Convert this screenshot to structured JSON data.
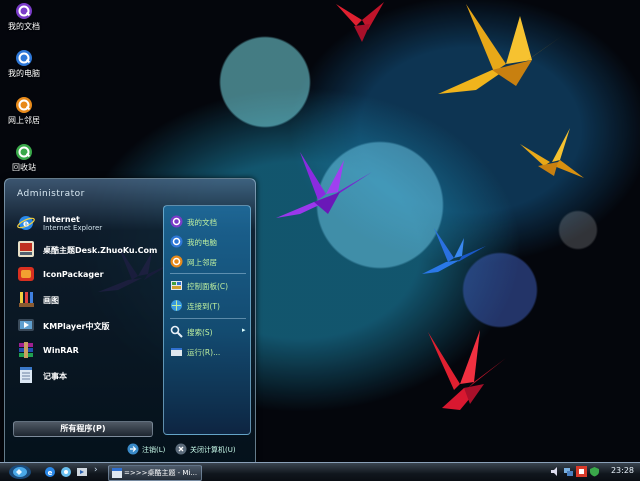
{
  "desktop": {
    "icons": [
      {
        "label": "我的文档",
        "icon": "quicktime-style-q-icon"
      },
      {
        "label": "我的电脑",
        "icon": "quicktime-style-q-icon"
      },
      {
        "label": "网上邻居",
        "icon": "quicktime-style-q-icon"
      },
      {
        "label": "回收站",
        "icon": "quicktime-style-q-icon"
      }
    ],
    "accent_colors": {
      "crane_red": "#d81830",
      "crane_yellow": "#f0b020",
      "crane_purple": "#9030e0",
      "crane_blue": "#2a70e0"
    }
  },
  "start_menu": {
    "user": "Administrator",
    "pinned": [
      {
        "title": "Internet",
        "subtitle": "Internet Explorer",
        "icon": "internet-explorer-icon"
      },
      {
        "title": "桌酷主题Desk.ZhuoKu.Com",
        "icon": "theme-app-icon"
      },
      {
        "title": "IconPackager",
        "icon": "iconpackager-icon"
      },
      {
        "title": "画图",
        "icon": "paint-brush-icon"
      },
      {
        "title": "KMPlayer中文版",
        "icon": "kmplayer-icon"
      },
      {
        "title": "WinRAR",
        "icon": "winrar-icon"
      },
      {
        "title": "记事本",
        "icon": "notepad-icon"
      }
    ],
    "places": [
      {
        "label": "我的文档",
        "icon": "documents-icon"
      },
      {
        "label": "我的电脑",
        "icon": "computer-icon"
      },
      {
        "label": "网上邻居",
        "icon": "network-icon"
      },
      {
        "label": "控制面板(C)",
        "icon": "control-panel-icon"
      },
      {
        "label": "连接到(T)",
        "icon": "connect-icon"
      },
      {
        "label": "搜索(S)",
        "icon": "search-icon"
      },
      {
        "label": "运行(R)...",
        "icon": "run-icon"
      }
    ],
    "all_programs": "所有程序(P)",
    "logoff": "注销(L)",
    "shutdown": "关闭计算机(U)"
  },
  "taskbar": {
    "start_icon": "start-orb-icon",
    "quick_launch": [
      "internet-explorer-icon",
      "show-desktop-icon",
      "media-icon"
    ],
    "chevron": "›",
    "task_label": "=>>>桌酷主题 - Mi...",
    "tray_icons": [
      "volume-icon",
      "network-tray-icon",
      "input-method-icon",
      "security-icon"
    ],
    "clock": "23:28"
  }
}
